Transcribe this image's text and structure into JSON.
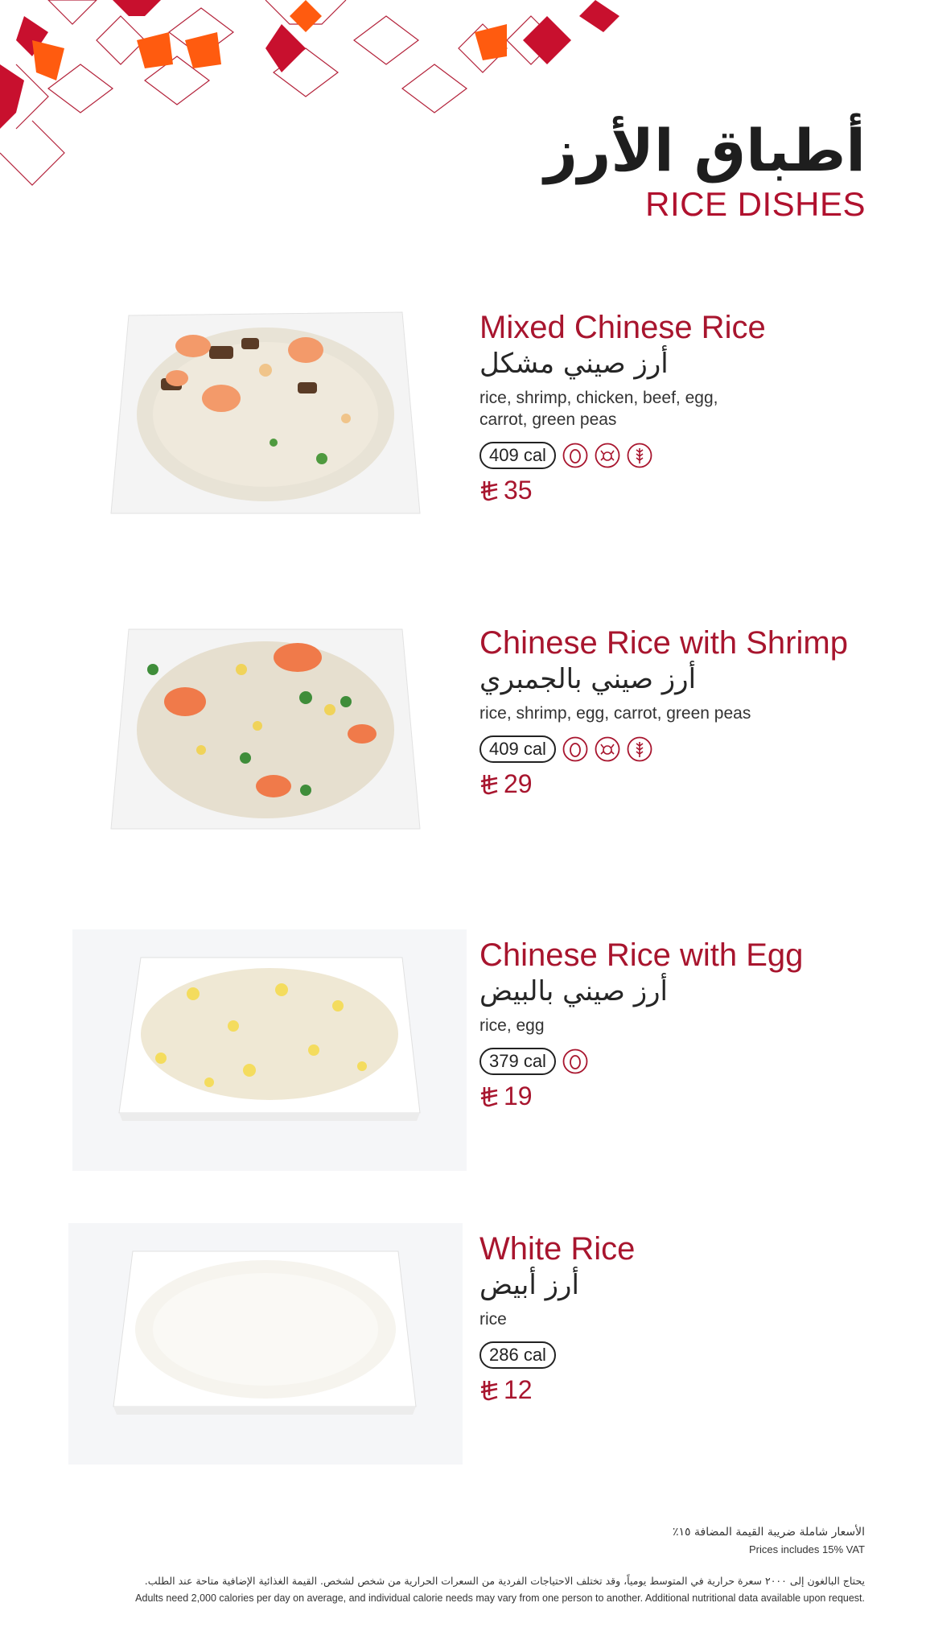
{
  "header": {
    "title_ar": "أطباق الأرز",
    "title_en": "RICE DISHES"
  },
  "items": [
    {
      "name_en": "Mixed Chinese Rice",
      "name_ar": "أرز صيني مشكل",
      "description": "rice, shrimp, chicken, beef, egg, carrot, green peas",
      "calories": "409 cal",
      "allergens": [
        "egg-allergen-icon",
        "shellfish-allergen-icon",
        "gluten-allergen-icon"
      ],
      "price": "35",
      "photo": "rice-with-shrimp-beef-photo"
    },
    {
      "name_en": "Chinese Rice with Shrimp",
      "name_ar": "أرز صيني بالجمبري",
      "description": "rice, shrimp, egg, carrot, green peas",
      "calories": "409 cal",
      "allergens": [
        "egg-allergen-icon",
        "shellfish-allergen-icon",
        "gluten-allergen-icon"
      ],
      "price": "29",
      "photo": "rice-with-shrimp-photo"
    },
    {
      "name_en": "Chinese Rice with Egg",
      "name_ar": "أرز صيني بالبيض",
      "description": "rice, egg",
      "calories": "379 cal",
      "allergens": [
        "egg-allergen-icon"
      ],
      "price": "19",
      "photo": "rice-with-egg-photo"
    },
    {
      "name_en": "White Rice",
      "name_ar": "أرز أبيض",
      "description": "rice",
      "calories": "286 cal",
      "allergens": [],
      "price": "12",
      "photo": "white-rice-photo"
    }
  ],
  "footer": {
    "vat_ar": "الأسعار شاملة ضريبة القيمة المضافة ١٥٪",
    "vat_en": "Prices includes 15% VAT",
    "calorie_note_ar": "يحتاج البالغون إلى ٢٠٠٠ سعرة حرارية في المتوسط يومياً، وقد تختلف الاحتياجات الفردية من السعرات الحرارية من شخص لشخص. القيمة الغذائية الإضافية متاحة عند الطلب.",
    "calorie_note_en": "Adults need 2,000 calories per day on average, and individual calorie needs may vary from one person to another. Additional nutritional data available upon request."
  },
  "colors": {
    "accent_red": "#a8152e",
    "pattern_red": "#c8102e",
    "pattern_orange": "#ff5b0f"
  }
}
